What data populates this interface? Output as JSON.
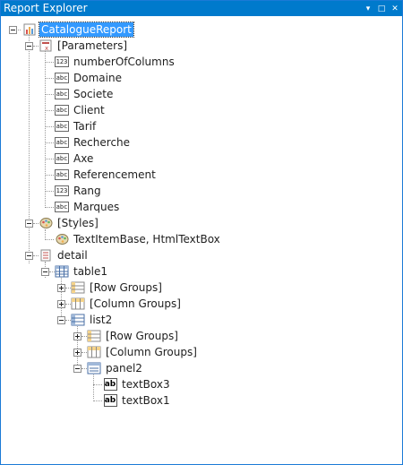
{
  "panel": {
    "title": "Report Explorer",
    "pin_glyph": "▾",
    "float_glyph": "□",
    "close_glyph": "✕"
  },
  "tree": {
    "root": "CatalogueReport",
    "parameters": {
      "label": "[Parameters]",
      "items": [
        {
          "label": "numberOfColumns",
          "icon": "123"
        },
        {
          "label": "Domaine",
          "icon": "abc"
        },
        {
          "label": "Societe",
          "icon": "abc"
        },
        {
          "label": "Client",
          "icon": "abc"
        },
        {
          "label": "Tarif",
          "icon": "abc"
        },
        {
          "label": "Recherche",
          "icon": "abc"
        },
        {
          "label": "Axe",
          "icon": "abc"
        },
        {
          "label": "Referencement",
          "icon": "abc"
        },
        {
          "label": "Rang",
          "icon": "123"
        },
        {
          "label": "Marques",
          "icon": "abc"
        }
      ]
    },
    "styles": {
      "label": "[Styles]",
      "item": "TextItemBase, HtmlTextBox"
    },
    "detail": {
      "label": "detail",
      "table1": {
        "label": "table1",
        "row_groups": "[Row Groups]",
        "column_groups": "[Column Groups]",
        "list2": {
          "label": "list2",
          "row_groups": "[Row Groups]",
          "column_groups": "[Column Groups]",
          "panel2": {
            "label": "panel2",
            "textbox3": "textBox3",
            "textbox1": "textBox1",
            "ab_glyph": "ab"
          }
        }
      }
    }
  }
}
